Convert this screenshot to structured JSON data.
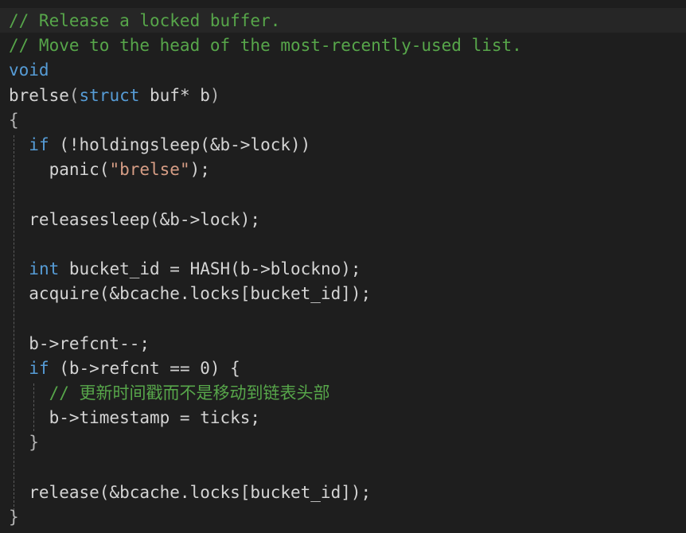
{
  "editor": {
    "colors": {
      "background": "#1e1e1e",
      "text": "#d4d4d4",
      "comment": "#57a64a",
      "keyword": "#569cd6",
      "string": "#d69d85"
    },
    "lines": [
      [
        [
          "c",
          "// Release a locked buffer."
        ]
      ],
      [
        [
          "c",
          "// Move to the head of the most-recently-used list."
        ]
      ],
      [
        [
          "k",
          "void"
        ]
      ],
      [
        [
          "n",
          "brelse"
        ],
        [
          "p",
          "("
        ],
        [
          "k",
          "struct"
        ],
        [
          "n",
          " buf* b"
        ],
        [
          "p",
          ")"
        ]
      ],
      [
        [
          "p",
          "{"
        ]
      ],
      [
        [
          "n",
          "  "
        ],
        [
          "k",
          "if"
        ],
        [
          "n",
          " (!holdingsleep(&b->lock))"
        ]
      ],
      [
        [
          "n",
          "    panic("
        ],
        [
          "s",
          "\"brelse\""
        ],
        [
          "n",
          ");"
        ]
      ],
      [],
      [
        [
          "n",
          "  releasesleep(&b->lock);"
        ]
      ],
      [],
      [
        [
          "n",
          "  "
        ],
        [
          "k",
          "int"
        ],
        [
          "n",
          " bucket_id = HASH(b->blockno);"
        ]
      ],
      [
        [
          "n",
          "  acquire(&bcache.locks[bucket_id]);"
        ]
      ],
      [],
      [
        [
          "n",
          "  b->refcnt--;"
        ]
      ],
      [
        [
          "n",
          "  "
        ],
        [
          "k",
          "if"
        ],
        [
          "n",
          " (b->refcnt == 0) {"
        ]
      ],
      [
        [
          "n",
          "    "
        ],
        [
          "c",
          "// 更新时间戳而不是移动到链表头部"
        ]
      ],
      [
        [
          "n",
          "    b->timestamp = ticks;"
        ]
      ],
      [
        [
          "n",
          "  "
        ],
        [
          "p",
          "}"
        ]
      ],
      [],
      [
        [
          "n",
          "  release(&bcache.locks[bucket_id]);"
        ]
      ],
      [
        [
          "p",
          "}"
        ]
      ]
    ]
  }
}
